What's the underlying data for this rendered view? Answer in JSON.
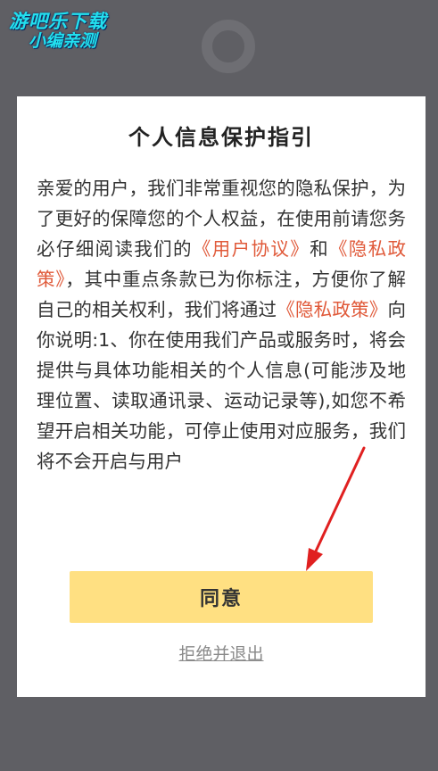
{
  "watermark": {
    "line1": "游吧乐下载",
    "line2": "小编亲测"
  },
  "dialog": {
    "title": "个人信息保护指引",
    "body": {
      "intro": "亲爱的用户，我们非常重视您的隐私保护，为了更好的保障您的个人权益，在使用前请您务必仔细阅读我们的",
      "user_agreement_link": "《用户协议》",
      "and": "和",
      "privacy_policy_link": "《隐私政策》",
      "middle": "，其中重点条款已为你标注，方便你了解自己的相关权利，我们将通过",
      "privacy_policy_link_2": "《隐私政策》",
      "rest": "向你说明:1、你在使用我们产品或服务时，将会提供与具体功能相关的个人信息(可能涉及地理位置、读取通讯录、运动记录等),如您不希望开启相关功能，可停止使用对应服务，我们将不会开启与用户"
    },
    "agree_label": "同意",
    "decline_label": "拒绝并退出"
  },
  "colors": {
    "overlay_bg": "#5f5f64",
    "dialog_bg": "#ffffff",
    "link": "#e05a3a",
    "agree_button_bg": "#ffe082",
    "decline_text": "#8a8a8a",
    "watermark": "#22e0ef",
    "arrow": "#e02020"
  }
}
